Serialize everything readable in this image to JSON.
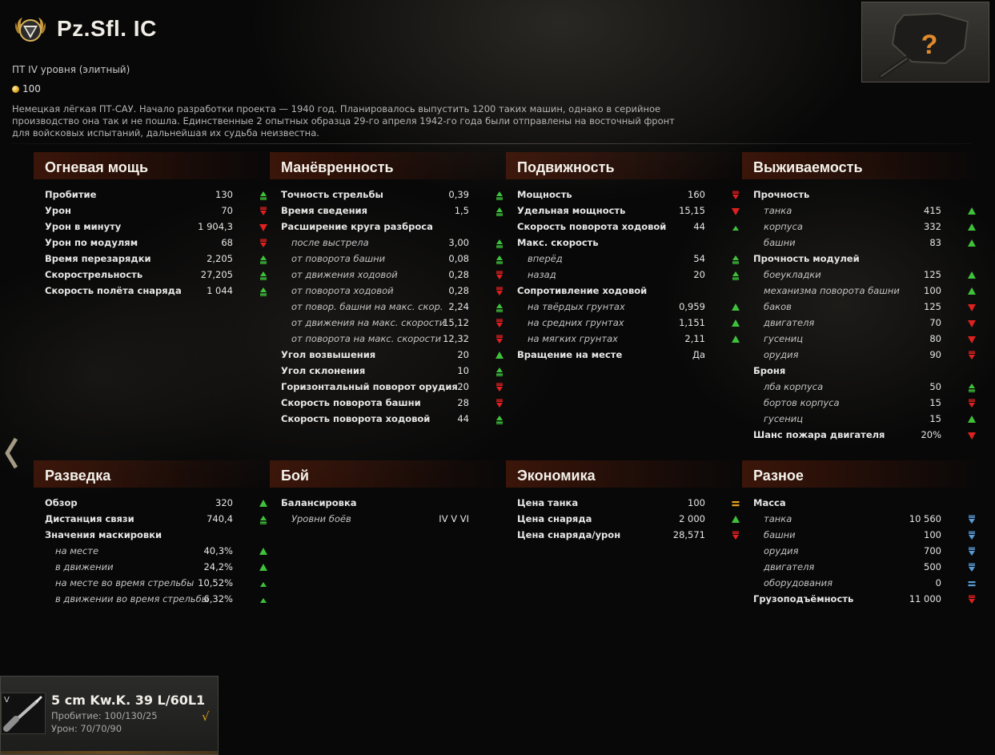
{
  "tank": {
    "name": "Pz.Sfl. IC",
    "subtitle": "ПТ IV уровня (элитный)",
    "price": "100",
    "description": "Немецкая лёгкая ПТ-САУ. Начало разработки проекта — 1940 год. Планировалось выпустить 1200 таких машин, однако в серийное производство она так и не пошла. Единственные 2 опытных образца 29-го апреля 1942-го года были отправлены на восточный фронт для войсковых испытаний, дальнейшая их судьба неизвестна."
  },
  "icons": {
    "emblem": "elite-rank-emblem-icon",
    "thumbnail": "unknown-tank-question-icon",
    "nav": "chevron-left-icon",
    "coin": "credits-coin-icon",
    "module": "gun-icon",
    "check": "checkmark-icon"
  },
  "colors": {
    "better": "#3fc23a",
    "worse": "#e02020",
    "equal_gold": "#e6a21f",
    "equal_blue": "#5a9bd6",
    "section_accent": "#6e220a"
  },
  "sections": [
    {
      "title": "Огневая мощь",
      "rows": [
        {
          "label": "Пробитие",
          "value": "130",
          "ind": "up-dash"
        },
        {
          "label": "Урон",
          "value": "70",
          "ind": "down-dash"
        },
        {
          "label": "Урон в минуту",
          "value": "1 904,3",
          "ind": "down"
        },
        {
          "label": "Урон по модулям",
          "value": "68",
          "ind": "down-dash"
        },
        {
          "label": "Время перезарядки",
          "value": "2,205",
          "ind": "up-dash"
        },
        {
          "label": "Скорострельность",
          "value": "27,205",
          "ind": "up-dash"
        },
        {
          "label": "Скорость полёта снаряда",
          "value": "1 044",
          "ind": "up-dash"
        }
      ]
    },
    {
      "title": "Манёвренность",
      "rows": [
        {
          "label": "Точность стрельбы",
          "value": "0,39",
          "ind": "up-dash"
        },
        {
          "label": "Время сведения",
          "value": "1,5",
          "ind": "up-dash"
        },
        {
          "label": "Расширение круга разброса",
          "value": "",
          "ind": ""
        },
        {
          "label": "после выстрела",
          "value": "3,00",
          "ind": "up-dash",
          "sub": true
        },
        {
          "label": "от поворота башни",
          "value": "0,08",
          "ind": "up-dash",
          "sub": true
        },
        {
          "label": "от движения ходовой",
          "value": "0,28",
          "ind": "down-dash",
          "sub": true
        },
        {
          "label": "от поворота ходовой",
          "value": "0,28",
          "ind": "down-dash",
          "sub": true
        },
        {
          "label": "от повор. башни на макс. скор.",
          "value": "2,24",
          "ind": "up-dash",
          "sub": true
        },
        {
          "label": "от движения на макс. скорости",
          "value": "15,12",
          "ind": "down-dash",
          "sub": true
        },
        {
          "label": "от поворота на макс. скорости",
          "value": "12,32",
          "ind": "down-dash",
          "sub": true
        },
        {
          "label": "Угол возвышения",
          "value": "20",
          "ind": "up"
        },
        {
          "label": "Угол склонения",
          "value": "10",
          "ind": "up-dash"
        },
        {
          "label": "Горизонтальный поворот орудия",
          "value": "20",
          "ind": "down-dash"
        },
        {
          "label": "Скорость поворота башни",
          "value": "28",
          "ind": "down-dash"
        },
        {
          "label": "Скорость поворота ходовой",
          "value": "44",
          "ind": "up-dash"
        }
      ]
    },
    {
      "title": "Подвижность",
      "rows": [
        {
          "label": "Мощность",
          "value": "160",
          "ind": "down-dash"
        },
        {
          "label": "Удельная мощность",
          "value": "15,15",
          "ind": "down"
        },
        {
          "label": "Скорость поворота ходовой",
          "value": "44",
          "ind": "up-small"
        },
        {
          "label": "Макс. скорость",
          "value": "",
          "ind": ""
        },
        {
          "label": "вперёд",
          "value": "54",
          "ind": "up-dash",
          "sub": true
        },
        {
          "label": "назад",
          "value": "20",
          "ind": "up-dash",
          "sub": true
        },
        {
          "label": "Сопротивление ходовой",
          "value": "",
          "ind": ""
        },
        {
          "label": "на твёрдых грунтах",
          "value": "0,959",
          "ind": "up",
          "sub": true
        },
        {
          "label": "на средних грунтах",
          "value": "1,151",
          "ind": "up",
          "sub": true
        },
        {
          "label": "на мягких грунтах",
          "value": "2,11",
          "ind": "up",
          "sub": true
        },
        {
          "label": "Вращение на месте",
          "value": "Да",
          "ind": ""
        }
      ]
    },
    {
      "title": "Выживаемость",
      "rows": [
        {
          "label": "Прочность",
          "value": "",
          "ind": ""
        },
        {
          "label": "танка",
          "value": "415",
          "ind": "up",
          "sub": true
        },
        {
          "label": "корпуса",
          "value": "332",
          "ind": "up",
          "sub": true
        },
        {
          "label": "башни",
          "value": "83",
          "ind": "up",
          "sub": true
        },
        {
          "label": "Прочность модулей",
          "value": "",
          "ind": ""
        },
        {
          "label": "боеукладки",
          "value": "125",
          "ind": "up",
          "sub": true
        },
        {
          "label": "механизма поворота башни",
          "value": "100",
          "ind": "up",
          "sub": true
        },
        {
          "label": "баков",
          "value": "125",
          "ind": "down",
          "sub": true
        },
        {
          "label": "двигателя",
          "value": "70",
          "ind": "down",
          "sub": true
        },
        {
          "label": "гусениц",
          "value": "80",
          "ind": "down",
          "sub": true
        },
        {
          "label": "орудия",
          "value": "90",
          "ind": "down-dash",
          "sub": true
        },
        {
          "label": "Броня",
          "value": "",
          "ind": ""
        },
        {
          "label": "лба корпуса",
          "value": "50",
          "ind": "up-dash",
          "sub": true
        },
        {
          "label": "бортов корпуса",
          "value": "15",
          "ind": "down-dash",
          "sub": true
        },
        {
          "label": "гусениц",
          "value": "15",
          "ind": "up",
          "sub": true
        },
        {
          "label": "Шанс пожара двигателя",
          "value": "20%",
          "ind": "down"
        }
      ]
    },
    {
      "title": "Разведка",
      "rows": [
        {
          "label": "Обзор",
          "value": "320",
          "ind": "up"
        },
        {
          "label": "Дистанция связи",
          "value": "740,4",
          "ind": "up-dash"
        },
        {
          "label": "Значения маскировки",
          "value": "",
          "ind": ""
        },
        {
          "label": "на месте",
          "value": "40,3%",
          "ind": "up",
          "sub": true
        },
        {
          "label": "в движении",
          "value": "24,2%",
          "ind": "up",
          "sub": true
        },
        {
          "label": "на месте во время стрельбы",
          "value": "10,52%",
          "ind": "up-small",
          "sub": true
        },
        {
          "label": "в движении во время стрельбы",
          "value": "6,32%",
          "ind": "up-small",
          "sub": true
        }
      ]
    },
    {
      "title": "Бой",
      "rows": [
        {
          "label": "Балансировка",
          "value": "",
          "ind": ""
        },
        {
          "label": "Уровни боёв",
          "value": "IV V VI",
          "ind": "",
          "sub": true
        }
      ]
    },
    {
      "title": "Экономика",
      "rows": [
        {
          "label": "Цена танка",
          "value": "100",
          "ind": "eq-gold"
        },
        {
          "label": "Цена снаряда",
          "value": "2 000",
          "ind": "up"
        },
        {
          "label": "Цена снаряда/урон",
          "value": "28,571",
          "ind": "down-dash"
        }
      ]
    },
    {
      "title": "Разное",
      "rows": [
        {
          "label": "Масса",
          "value": "",
          "ind": ""
        },
        {
          "label": "танка",
          "value": "10 560",
          "ind": "down-blue",
          "sub": true
        },
        {
          "label": "башни",
          "value": "100",
          "ind": "down-blue",
          "sub": true
        },
        {
          "label": "орудия",
          "value": "700",
          "ind": "down-blue",
          "sub": true
        },
        {
          "label": "двигателя",
          "value": "500",
          "ind": "down-blue",
          "sub": true
        },
        {
          "label": "оборудования",
          "value": "0",
          "ind": "eq-blue",
          "sub": true
        },
        {
          "label": "Грузоподъёмность",
          "value": "11 000",
          "ind": "down-dash"
        }
      ]
    }
  ],
  "module": {
    "tier": "V",
    "name": "5 cm Kw.K. 39 L/60L1",
    "penetration": "Пробитие: 100/130/25",
    "damage": "Урон: 70/70/90",
    "check": "√"
  }
}
